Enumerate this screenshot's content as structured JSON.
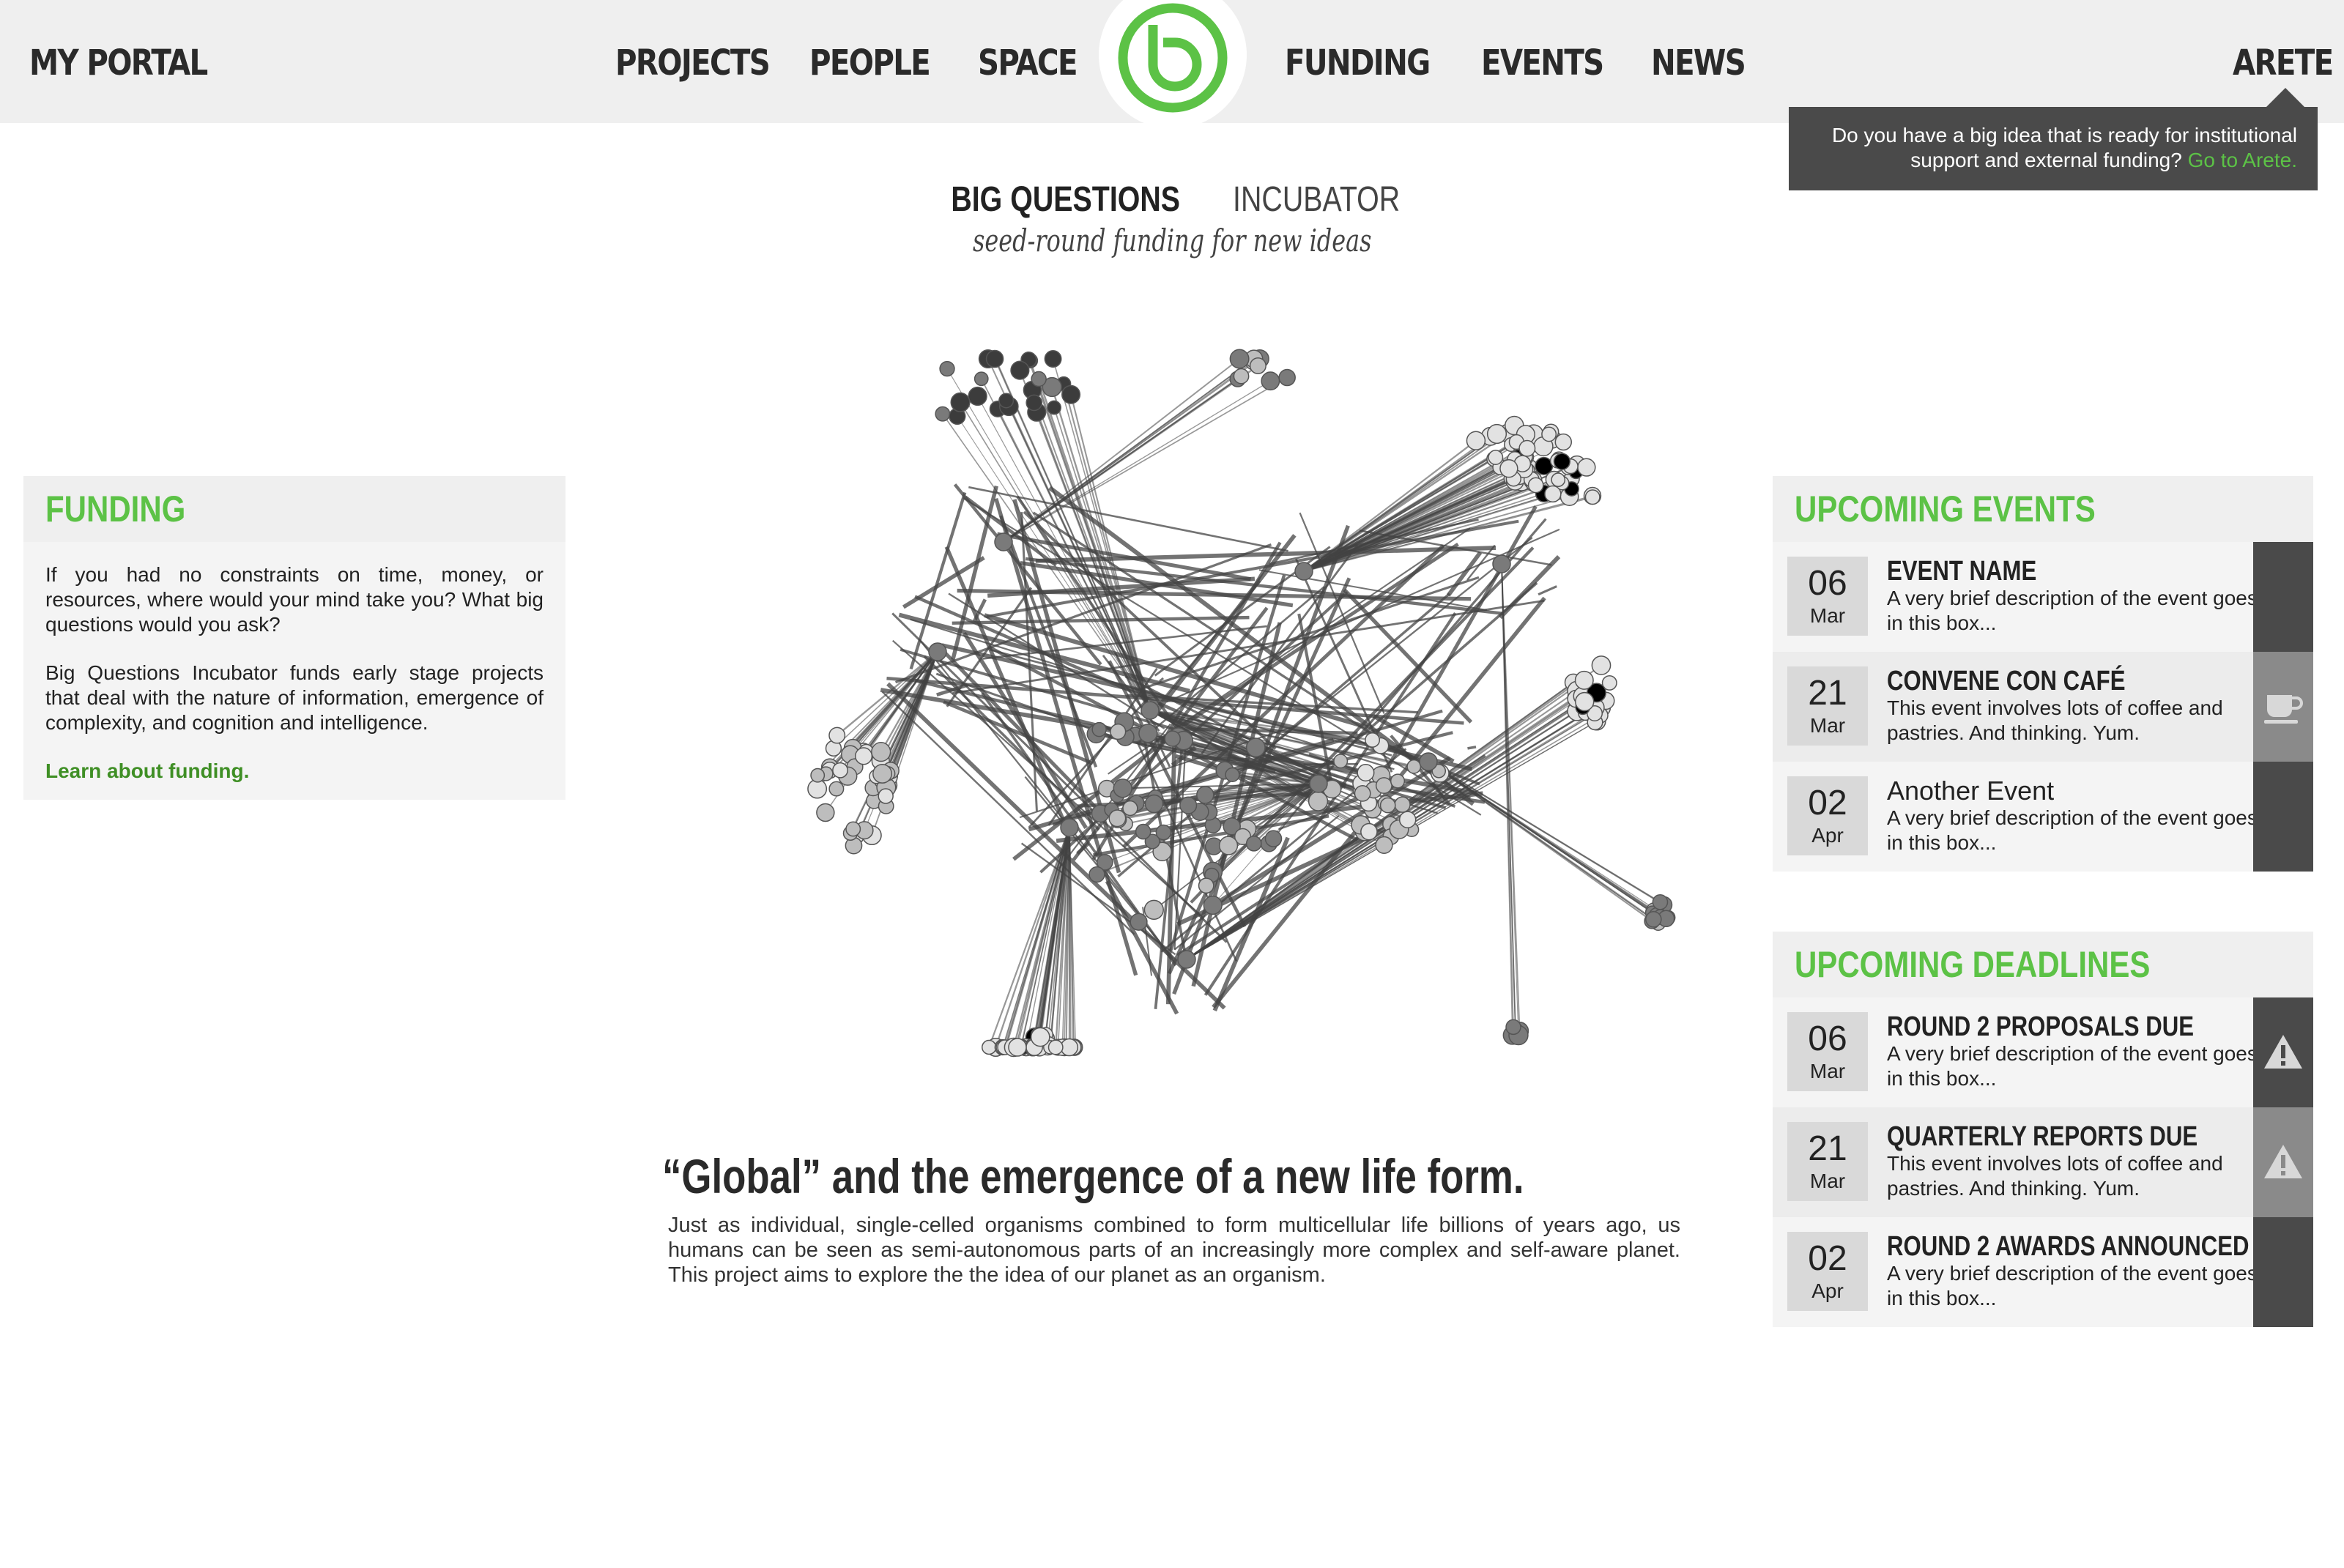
{
  "header": {
    "portal_label": "MY PORTAL",
    "nav_left": [
      "PROJECTS",
      "PEOPLE",
      "SPACE"
    ],
    "nav_right": [
      "FUNDING",
      "EVENTS",
      "NEWS"
    ],
    "account_label": "ARETE",
    "logo_icon": "bq-logo-icon",
    "accent_color": "#5cc246"
  },
  "arete_tooltip": {
    "text": "Do you have a big idea that is ready for institutional support and external funding?",
    "link": "Go to Arete."
  },
  "page_title": {
    "strong": "BIG QUESTIONS",
    "light": "INCUBATOR",
    "subtitle": "seed-round funding for new ideas"
  },
  "network_image": {
    "icon": "network-graph-image",
    "node_colors": [
      "#3c3c3c",
      "#7a7a7a",
      "#bdbdbd",
      "#e2e2e2"
    ]
  },
  "article": {
    "title": "“Global” and the emergence of a new life form.",
    "body": "Just as individual, single-celled organisms combined to form multicellular life billions of years ago, us humans can be seen as semi-autonomous parts of an increasingly more complex and self-aware planet. This project aims to explore the the idea of our planet as an organism."
  },
  "funding": {
    "heading": "FUNDING",
    "paragraph_1": "If you had no constraints on time, money, or resources, where would your mind take you? What big questions would you ask?",
    "paragraph_2": "Big Questions Incubator funds early stage projects that deal with the nature of information, emergence of complexity, and cognition and intelligence.",
    "link": "Learn about funding."
  },
  "events": {
    "heading": "UPCOMING EVENTS",
    "items": [
      {
        "day": "06",
        "month": "Mar",
        "title": "EVENT NAME",
        "desc": "A very brief description of the event goes in this box...",
        "icon": ""
      },
      {
        "day": "21",
        "month": "Mar",
        "title": "CONVENE CON CAFÉ",
        "desc": "This event involves lots of coffee and pastries. And thinking. Yum.",
        "icon": "coffee-cup-icon"
      },
      {
        "day": "02",
        "month": "Apr",
        "title": "Another Event",
        "desc": "A very brief description of the event goes in this box...",
        "icon": ""
      }
    ]
  },
  "deadlines": {
    "heading": "UPCOMING DEADLINES",
    "items": [
      {
        "day": "06",
        "month": "Mar",
        "title": "ROUND 2 PROPOSALS DUE",
        "desc": "A very brief description of the event goes in this box...",
        "icon": "warning-icon"
      },
      {
        "day": "21",
        "month": "Mar",
        "title": "QUARTERLY REPORTS DUE",
        "desc": "This event involves lots of coffee and pastries. And thinking. Yum.",
        "icon": "warning-icon"
      },
      {
        "day": "02",
        "month": "Apr",
        "title": "ROUND 2 AWARDS ANNOUNCED",
        "desc": "A very brief description of the event goes in this box...",
        "icon": ""
      }
    ]
  }
}
